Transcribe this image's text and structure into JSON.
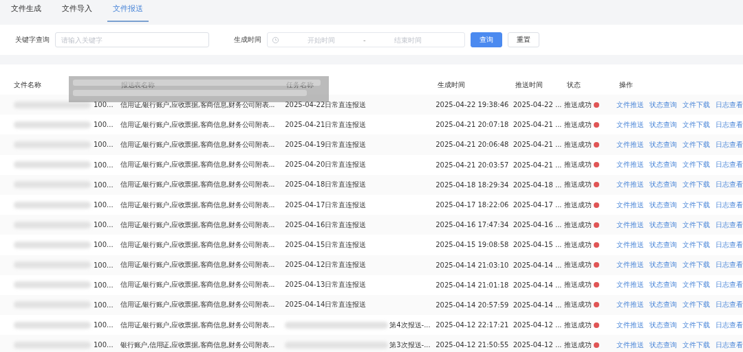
{
  "tabs": [
    {
      "label": "文件生成",
      "selected": false
    },
    {
      "label": "文件导入",
      "selected": false
    },
    {
      "label": "文件报送",
      "selected": true
    }
  ],
  "filters": {
    "keyword_label": "关键字查询",
    "keyword_placeholder": "请输入关键字",
    "time_label": "生成时间",
    "start_placeholder": "开始时间",
    "separator": "-",
    "end_placeholder": "结束时间",
    "search_button": "查询",
    "reset_button": "重置"
  },
  "table": {
    "columns": [
      "文件名称",
      "报送表名称",
      "任务名称",
      "生成时间",
      "推送时间",
      "状态",
      "操作"
    ],
    "rows": [
      {
        "file_name": "100...",
        "file_name_redacted": true,
        "report_tables": "信用证,银行账户,应收票据,客商信息,财务公司附表...",
        "task_name": "2025-04-22日常直连报送",
        "task_name_redacted": false,
        "generated": "2025-04-22 19:38:46",
        "pushed": "2025-04-22 ...",
        "status": "推送成功",
        "actions": [
          "文件推送",
          "状态查询",
          "文件下载",
          "日志查看"
        ]
      },
      {
        "file_name": "100...",
        "file_name_redacted": true,
        "report_tables": "信用证,银行账户,应收票据,客商信息,财务公司附表...",
        "task_name": "2025-04-21日常直连报送",
        "task_name_redacted": false,
        "generated": "2025-04-21 20:07:18",
        "pushed": "2025-04-21 ...",
        "status": "推送成功",
        "actions": [
          "文件推送",
          "状态查询",
          "文件下载",
          "日志查看"
        ]
      },
      {
        "file_name": "100...",
        "file_name_redacted": true,
        "report_tables": "信用证,银行账户,应收票据,客商信息,财务公司附表...",
        "task_name": "2025-04-19日常直连报送",
        "task_name_redacted": false,
        "generated": "2025-04-21 20:06:48",
        "pushed": "2025-04-21 ...",
        "status": "推送成功",
        "actions": [
          "文件推送",
          "状态查询",
          "文件下载",
          "日志查看"
        ]
      },
      {
        "file_name": "100...",
        "file_name_redacted": true,
        "report_tables": "信用证,银行账户,应收票据,客商信息,财务公司附表...",
        "task_name": "2025-04-20日常直连报送",
        "task_name_redacted": false,
        "generated": "2025-04-21 20:03:57",
        "pushed": "2025-04-21 ...",
        "status": "推送成功",
        "actions": [
          "文件推送",
          "状态查询",
          "文件下载",
          "日志查看"
        ]
      },
      {
        "file_name": "100...",
        "file_name_redacted": true,
        "report_tables": "信用证,银行账户,应收票据,客商信息,财务公司附表...",
        "task_name": "2025-04-18日常直连报送",
        "task_name_redacted": false,
        "generated": "2025-04-18 18:29:34",
        "pushed": "2025-04-18 ...",
        "status": "推送成功",
        "actions": [
          "文件推送",
          "状态查询",
          "文件下载",
          "日志查看"
        ]
      },
      {
        "file_name": "100...",
        "file_name_redacted": true,
        "report_tables": "信用证,银行账户,应收票据,客商信息,财务公司附表...",
        "task_name": "2025-04-17日常直连报送",
        "task_name_redacted": false,
        "generated": "2025-04-17 18:22:06",
        "pushed": "2025-04-17 ...",
        "status": "推送成功",
        "actions": [
          "文件推送",
          "状态查询",
          "文件下载",
          "日志查看"
        ]
      },
      {
        "file_name": "100...",
        "file_name_redacted": true,
        "report_tables": "信用证,银行账户,应收票据,客商信息,财务公司附表...",
        "task_name": "2025-04-16日常直连报送",
        "task_name_redacted": false,
        "generated": "2025-04-16 17:47:34",
        "pushed": "2025-04-16 ...",
        "status": "推送成功",
        "actions": [
          "文件推送",
          "状态查询",
          "文件下载",
          "日志查看"
        ]
      },
      {
        "file_name": "100...",
        "file_name_redacted": true,
        "report_tables": "信用证,银行账户,应收票据,客商信息,财务公司附表...",
        "task_name": "2025-04-15日常直连报送",
        "task_name_redacted": false,
        "generated": "2025-04-15 19:08:58",
        "pushed": "2025-04-15 ...",
        "status": "推送成功",
        "actions": [
          "文件推送",
          "状态查询",
          "文件下载",
          "日志查看"
        ]
      },
      {
        "file_name": "100...",
        "file_name_redacted": true,
        "report_tables": "信用证,银行账户,应收票据,客商信息,财务公司附表...",
        "task_name": "2025-04-12日常直连报送",
        "task_name_redacted": false,
        "generated": "2025-04-14 21:03:10",
        "pushed": "2025-04-14 ...",
        "status": "推送成功",
        "actions": [
          "文件推送",
          "状态查询",
          "文件下载",
          "日志查看"
        ]
      },
      {
        "file_name": "100...",
        "file_name_redacted": true,
        "report_tables": "信用证,银行账户,应收票据,客商信息,财务公司附表...",
        "task_name": "2025-04-13日常直连报送",
        "task_name_redacted": false,
        "generated": "2025-04-14 21:01:18",
        "pushed": "2025-04-14 ...",
        "status": "推送成功",
        "actions": [
          "文件推送",
          "状态查询",
          "文件下载",
          "日志查看"
        ]
      },
      {
        "file_name": "100...",
        "file_name_redacted": true,
        "report_tables": "信用证,银行账户,应收票据,客商信息,财务公司附表...",
        "task_name": "2025-04-14日常直连报送",
        "task_name_redacted": false,
        "generated": "2025-04-14 20:57:59",
        "pushed": "2025-04-14 ...",
        "status": "推送成功",
        "actions": [
          "文件推送",
          "状态查询",
          "文件下载",
          "日志查看"
        ]
      },
      {
        "file_name": "100...",
        "file_name_redacted": true,
        "report_tables": "信用证,银行账户,应收票据,客商信息,财务公司附表...",
        "task_name": "第4次报送-...",
        "task_name_redacted": true,
        "generated": "2025-04-12 22:17:21",
        "pushed": "2025-04-12 ...",
        "status": "推送成功",
        "actions": [
          "文件推送",
          "状态查询",
          "文件下载",
          "日志查看"
        ]
      },
      {
        "file_name": "100...",
        "file_name_redacted": true,
        "report_tables": "银行账户,信用证,应收票据,客商信息,财务公司附表...",
        "task_name": "第3次报送-...",
        "task_name_redacted": true,
        "generated": "2025-04-12 21:50:55",
        "pushed": "2025-04-12 ...",
        "status": "推送成功",
        "actions": [
          "文件推送",
          "状态查询",
          "文件下载",
          "日志查看"
        ]
      }
    ]
  }
}
